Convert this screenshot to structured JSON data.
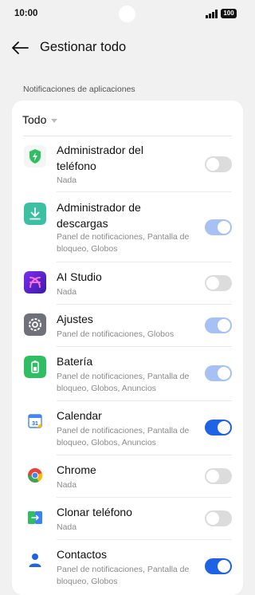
{
  "status_bar": {
    "time": "10:00",
    "battery": "100"
  },
  "header": {
    "title": "Gestionar todo"
  },
  "section_title": "Notificaciones de aplicaciones",
  "filter": {
    "label": "Todo"
  },
  "apps": [
    {
      "name": "Administrador del teléfono",
      "subtitle": "Nada",
      "toggle": "off",
      "icon": "phone-manager-icon"
    },
    {
      "name": "Administrador de descargas",
      "subtitle": "Panel de notificaciones, Pantalla de bloqueo, Globos",
      "toggle": "on-disabled",
      "icon": "download-manager-icon"
    },
    {
      "name": "AI Studio",
      "subtitle": "Nada",
      "toggle": "off",
      "icon": "ai-studio-icon"
    },
    {
      "name": "Ajustes",
      "subtitle": "Panel de notificaciones, Globos",
      "toggle": "on-disabled",
      "icon": "settings-icon"
    },
    {
      "name": "Batería",
      "subtitle": "Panel de notificaciones, Pantalla de bloqueo, Globos, Anuncios",
      "toggle": "on-disabled",
      "icon": "battery-app-icon"
    },
    {
      "name": "Calendar",
      "subtitle": "Panel de notificaciones, Pantalla de bloqueo, Globos, Anuncios",
      "toggle": "on",
      "icon": "calendar-icon"
    },
    {
      "name": "Chrome",
      "subtitle": "Nada",
      "toggle": "off",
      "icon": "chrome-icon"
    },
    {
      "name": "Clonar teléfono",
      "subtitle": "Nada",
      "toggle": "off",
      "icon": "clone-phone-icon"
    },
    {
      "name": "Contactos",
      "subtitle": "Panel de notificaciones, Pantalla de bloqueo, Globos",
      "toggle": "on",
      "icon": "contacts-icon"
    }
  ],
  "colors": {
    "accent": "#1e63e6",
    "accent_disabled": "#a7c1f4",
    "toggle_off": "#dcdcdc",
    "background": "#f1f1f1"
  }
}
